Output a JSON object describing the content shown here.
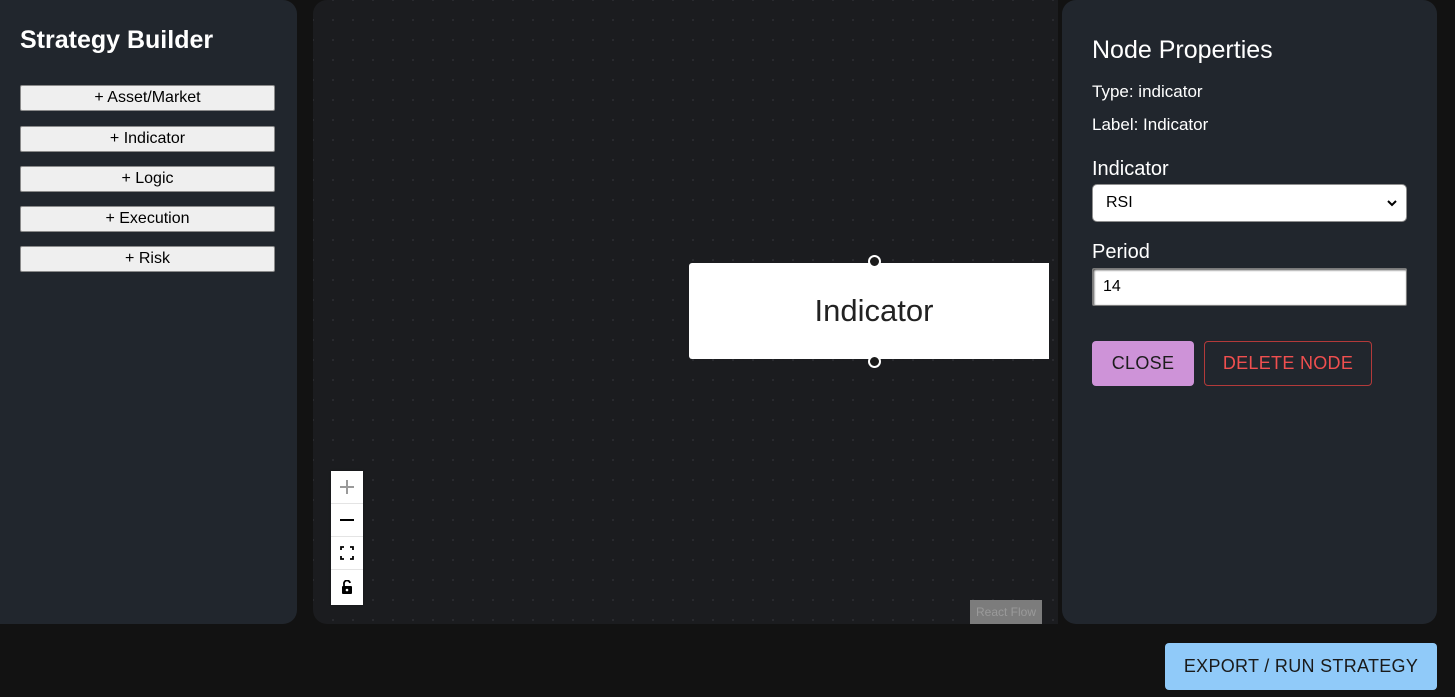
{
  "sidebar": {
    "title": "Strategy Builder",
    "buttons": [
      {
        "label": "+ Asset/Market"
      },
      {
        "label": "+ Indicator"
      },
      {
        "label": "+ Logic"
      },
      {
        "label": "+ Execution"
      },
      {
        "label": "+ Risk"
      }
    ]
  },
  "canvas": {
    "node": {
      "label": "Indicator"
    },
    "controls": [
      {
        "icon": "plus-icon"
      },
      {
        "icon": "minus-icon"
      },
      {
        "icon": "fit-view-icon"
      },
      {
        "icon": "unlock-icon"
      }
    ],
    "attribution": "React Flow"
  },
  "properties": {
    "title": "Node Properties",
    "type_text": "Type: indicator",
    "label_text": "Label: Indicator",
    "indicator_label": "Indicator",
    "indicator_value": "RSI",
    "period_label": "Period",
    "period_value": "14",
    "close_label": "CLOSE",
    "delete_label": "DELETE NODE"
  },
  "footer": {
    "export_label": "EXPORT / RUN STRATEGY"
  },
  "colors": {
    "accent_close": "#ce93d8",
    "accent_export": "#90caf9",
    "danger": "#f04f4f"
  }
}
